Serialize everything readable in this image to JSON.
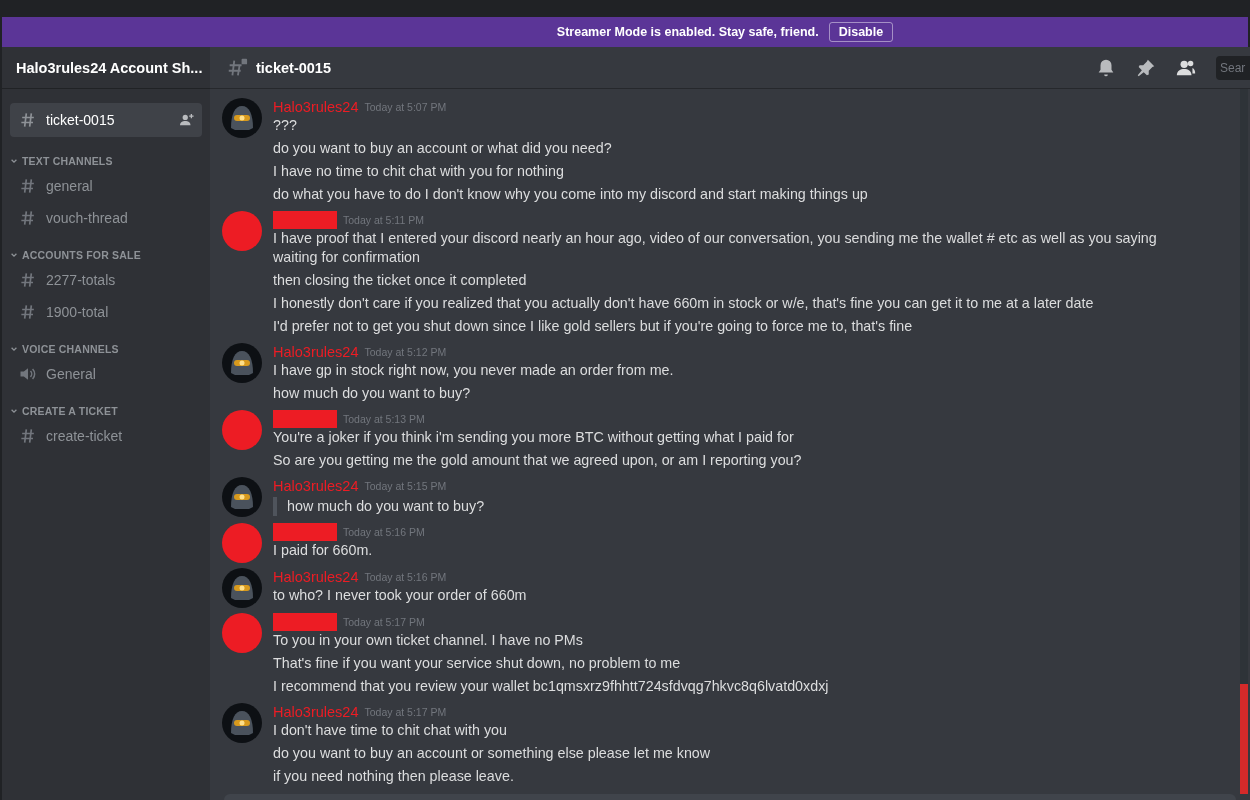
{
  "banner": {
    "text": "Streamer Mode is enabled. Stay safe, friend.",
    "button": "Disable"
  },
  "server": {
    "name": "Halo3rules24 Account Sh..."
  },
  "sidebar": {
    "top_channel": {
      "name": "ticket-0015",
      "selected": true
    },
    "categories": [
      {
        "name": "TEXT CHANNELS",
        "expanded": true,
        "channels": [
          {
            "kind": "text",
            "name": "general",
            "selected": false
          },
          {
            "kind": "text",
            "name": "vouch-thread",
            "selected": false
          }
        ]
      },
      {
        "name": "ACCOUNTS FOR SALE",
        "expanded": true,
        "channels": [
          {
            "kind": "text",
            "name": "2277-totals",
            "selected": false
          },
          {
            "kind": "text",
            "name": "1900-total",
            "selected": false
          }
        ]
      },
      {
        "name": "VOICE CHANNELS",
        "expanded": true,
        "channels": [
          {
            "kind": "voice",
            "name": "General",
            "selected": false
          }
        ]
      },
      {
        "name": "CREATE A TICKET",
        "expanded": true,
        "channels": [
          {
            "kind": "text",
            "name": "create-ticket",
            "selected": false
          }
        ]
      }
    ]
  },
  "header": {
    "channel": "ticket-0015",
    "search": {
      "placeholder": "Sear"
    }
  },
  "messages": [
    {
      "author": {
        "kind": "named",
        "name": "Halo3rules24"
      },
      "time": "Today at 5:07 PM",
      "lines": [
        {
          "kind": "text",
          "text": "???"
        },
        {
          "kind": "text",
          "text": "do you want to buy an account or what did you need?"
        },
        {
          "kind": "text",
          "text": "I have no time to chit chat with you for nothing"
        },
        {
          "kind": "text",
          "text": "do what you have to do I don't know why you come into my discord and start making things up"
        }
      ]
    },
    {
      "author": {
        "kind": "redacted"
      },
      "time": "Today at 5:11 PM",
      "lines": [
        {
          "kind": "text",
          "text": "I have proof that I entered your discord nearly an hour ago, video of our conversation, you sending me the wallet # etc as well as you saying waiting for confirmation"
        },
        {
          "kind": "text",
          "text": "then closing the ticket once it completed"
        },
        {
          "kind": "text",
          "text": "I honestly don't care if you realized that you actually don't have 660m in stock or w/e, that's fine you can get it to me at a later date"
        },
        {
          "kind": "text",
          "text": "I'd prefer not to get you shut down since I like gold sellers but if you're going to force me to, that's fine"
        }
      ]
    },
    {
      "author": {
        "kind": "named",
        "name": "Halo3rules24"
      },
      "time": "Today at 5:12 PM",
      "lines": [
        {
          "kind": "text",
          "text": "I have gp in stock right now, you never made an order from me."
        },
        {
          "kind": "text",
          "text": "how much do you want to buy?"
        }
      ]
    },
    {
      "author": {
        "kind": "redacted"
      },
      "time": "Today at 5:13 PM",
      "lines": [
        {
          "kind": "text",
          "text": "You're a joker if you think i'm sending you more BTC without getting what I paid for"
        },
        {
          "kind": "text",
          "text": "So are you getting me the gold amount that we agreed upon, or am I reporting you?"
        }
      ]
    },
    {
      "author": {
        "kind": "named",
        "name": "Halo3rules24"
      },
      "time": "Today at 5:15 PM",
      "lines": [
        {
          "kind": "quote",
          "text": "how much do you want to buy?"
        }
      ]
    },
    {
      "author": {
        "kind": "redacted"
      },
      "time": "Today at 5:16 PM",
      "lines": [
        {
          "kind": "text",
          "text": "I paid for 660m."
        }
      ]
    },
    {
      "author": {
        "kind": "named",
        "name": "Halo3rules24"
      },
      "time": "Today at 5:16 PM",
      "lines": [
        {
          "kind": "text",
          "text": "to who? I never took your order of 660m"
        }
      ]
    },
    {
      "author": {
        "kind": "redacted"
      },
      "time": "Today at 5:17 PM",
      "lines": [
        {
          "kind": "text",
          "text": "To you in your own ticket channel. I have no PMs"
        },
        {
          "kind": "text",
          "text": "That's fine if you want your service shut down, no problem to me"
        },
        {
          "kind": "text",
          "text": "I recommend that you review your wallet bc1qmsxrz9fhhtt724sfdvqg7hkvc8q6lvatd0xdxj"
        }
      ]
    },
    {
      "author": {
        "kind": "named",
        "name": "Halo3rules24"
      },
      "time": "Today at 5:17 PM",
      "lines": [
        {
          "kind": "text",
          "text": "I don't have time to chit chat with you"
        },
        {
          "kind": "text",
          "text": "do you want to buy an account or something else please let me know"
        },
        {
          "kind": "text",
          "text": "if you need nothing then please leave."
        }
      ]
    }
  ]
}
